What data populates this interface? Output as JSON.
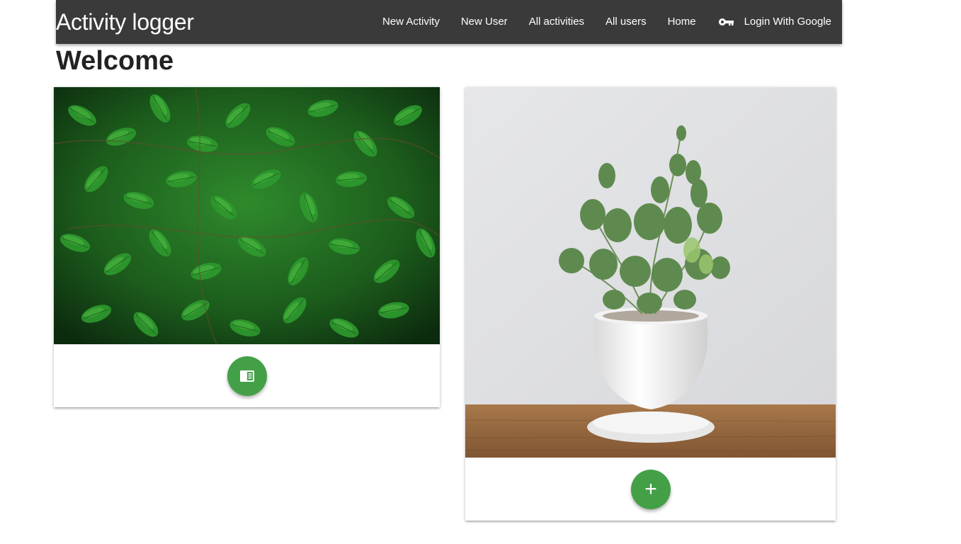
{
  "navbar": {
    "brand": "Activity logger",
    "links": [
      {
        "label": "New Activity"
      },
      {
        "label": "New User"
      },
      {
        "label": "All activities"
      },
      {
        "label": "All users"
      },
      {
        "label": "Home"
      }
    ],
    "login": {
      "label": "Login With Google",
      "icon": "key-icon"
    }
  },
  "page": {
    "title": "Welcome"
  },
  "cards": [
    {
      "image": "green-leaves-photo",
      "action_icon": "list-icon"
    },
    {
      "image": "potted-plant-photo",
      "action_icon": "add-icon",
      "action_glyph": "+"
    }
  ],
  "colors": {
    "navbar_bg": "#3a3a3a",
    "fab_green": "#43a047"
  }
}
